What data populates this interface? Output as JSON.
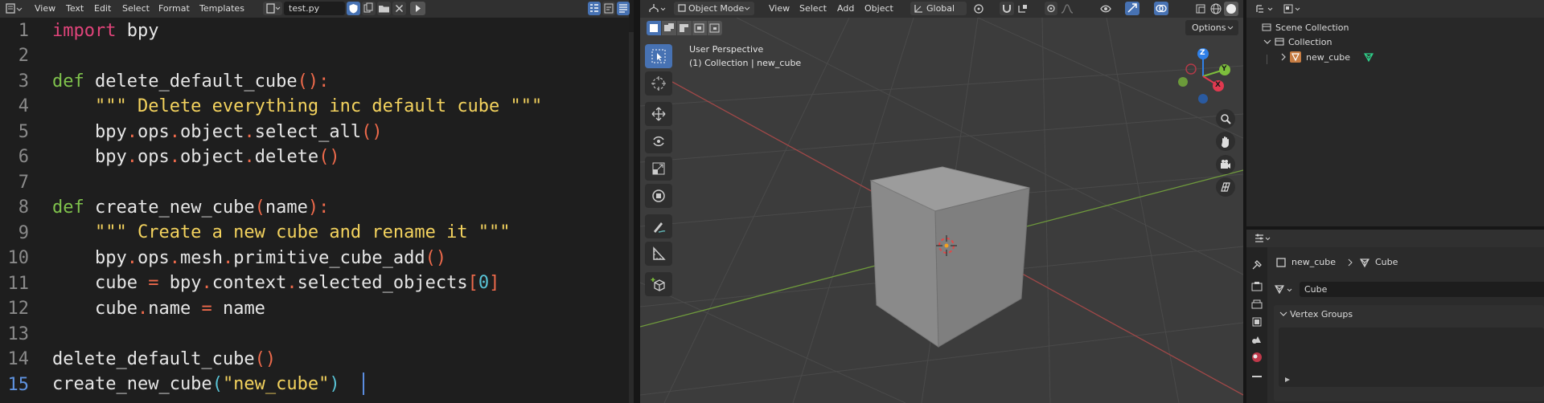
{
  "text_editor": {
    "menu": [
      "View",
      "Text",
      "Edit",
      "Select",
      "Format",
      "Templates"
    ],
    "filename": "test.py",
    "lines": [
      {
        "n": "1"
      },
      {
        "n": "2"
      },
      {
        "n": "3"
      },
      {
        "n": "4"
      },
      {
        "n": "5"
      },
      {
        "n": "6"
      },
      {
        "n": "7"
      },
      {
        "n": "8"
      },
      {
        "n": "9"
      },
      {
        "n": "10"
      },
      {
        "n": "11"
      },
      {
        "n": "12"
      },
      {
        "n": "13"
      },
      {
        "n": "14"
      },
      {
        "n": "15"
      }
    ],
    "code": {
      "l1_kw": "import",
      "l1_rest": " bpy",
      "l3_kw": "def",
      "l3_name": " delete_default_cube",
      "l3_open": "(",
      "l3_close": ")",
      "l3_colon": ":",
      "l4": "    \"\"\" Delete everything inc default cube \"\"\"",
      "l5_a": "    bpy",
      "l5_b": ".",
      "l5_c": "ops",
      "l5_d": ".",
      "l5_e": "object",
      "l5_f": ".",
      "l5_g": "select_all",
      "l5_h": "()",
      "l6_a": "    bpy",
      "l6_b": ".",
      "l6_c": "ops",
      "l6_d": ".",
      "l6_e": "object",
      "l6_f": ".",
      "l6_g": "delete",
      "l6_h": "()",
      "l8_kw": "def",
      "l8_name": " create_new_cube",
      "l8_open": "(",
      "l8_arg": "name",
      "l8_close": ")",
      "l8_colon": ":",
      "l9": "    \"\"\" Create a new cube and rename it \"\"\"",
      "l10_a": "    bpy",
      "l10_b": ".",
      "l10_c": "ops",
      "l10_d": ".",
      "l10_e": "mesh",
      "l10_f": ".",
      "l10_g": "primitive_cube_add",
      "l10_h": "()",
      "l11_a": "    cube ",
      "l11_b": "=",
      "l11_c": " bpy",
      "l11_d": ".",
      "l11_e": "context",
      "l11_f": ".",
      "l11_g": "selected_objects",
      "l11_h": "[",
      "l11_i": "0",
      "l11_j": "]",
      "l12_a": "    cube",
      "l12_b": ".",
      "l12_c": "name ",
      "l12_d": "=",
      "l12_e": " name",
      "l14_a": "delete_default_cube",
      "l14_b": "()",
      "l15_a": "create_new_cube",
      "l15_b": "(",
      "l15_c": "\"new_cube\"",
      "l15_d": ")"
    }
  },
  "viewport": {
    "mode": "Object Mode",
    "menu": [
      "View",
      "Select",
      "Add",
      "Object"
    ],
    "orientation": "Global",
    "options_label": "Options",
    "overlay_line1": "User Perspective",
    "overlay_line2": "(1) Collection | new_cube",
    "gizmo": {
      "z": "Z",
      "y": "Y",
      "x": "X"
    },
    "colors": {
      "x_axis": "#e0394f",
      "y_axis": "#7dbe3c",
      "z_axis": "#2f80e8",
      "active_tool": "#4772b3"
    }
  },
  "outliner": {
    "scene_collection": "Scene Collection",
    "collection": "Collection",
    "object": "new_cube"
  },
  "properties": {
    "breadcrumb_object": "new_cube",
    "breadcrumb_data": "Cube",
    "mesh_name": "Cube",
    "panel_title": "Vertex Groups"
  }
}
